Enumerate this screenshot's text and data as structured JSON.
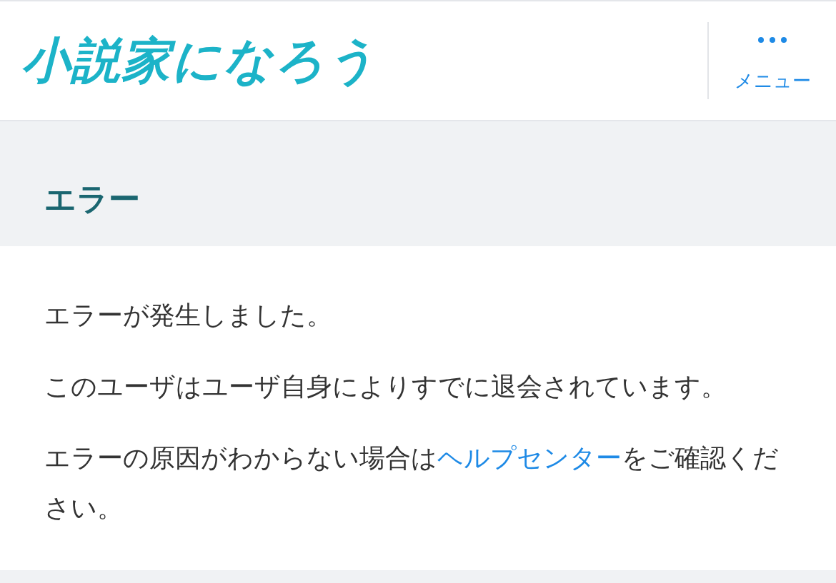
{
  "header": {
    "logo": "小説家になろう",
    "menu_label": "メニュー"
  },
  "heading": "エラー",
  "paragraphs": [
    {
      "kind": "plain",
      "text": "エラーが発生しました。"
    },
    {
      "kind": "plain",
      "text": "このユーザはユーザ自身によりすでに退会されています。"
    },
    {
      "kind": "link",
      "before": "エラーの原因がわからない場合は",
      "link": "ヘルプセンター",
      "after": "をご確認ください。"
    }
  ]
}
